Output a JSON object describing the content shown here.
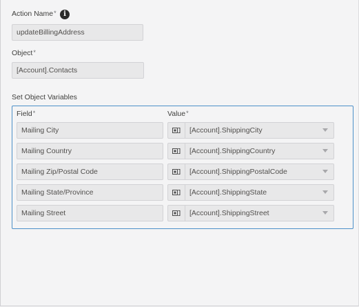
{
  "action_name": {
    "label": "Action Name",
    "required_mark": "*",
    "value": "updateBillingAddress",
    "info_icon": "info-icon"
  },
  "object": {
    "label": "Object",
    "required_mark": "*",
    "value": "[Account].Contacts"
  },
  "set_object_variables": {
    "label": "Set Object Variables",
    "field_header": "Field",
    "value_header": "Value",
    "required_mark": "*",
    "value_type_icon": "record-reference-icon",
    "dropdown_icon": "caret-down-icon",
    "rows": [
      {
        "field": "Mailing City",
        "value": "[Account].ShippingCity"
      },
      {
        "field": "Mailing Country",
        "value": "[Account].ShippingCountry"
      },
      {
        "field": "Mailing Zip/Postal Code",
        "value": "[Account].ShippingPostalCode"
      },
      {
        "field": "Mailing State/Province",
        "value": "[Account].ShippingState"
      },
      {
        "field": "Mailing Street",
        "value": "[Account].ShippingStreet"
      }
    ]
  }
}
